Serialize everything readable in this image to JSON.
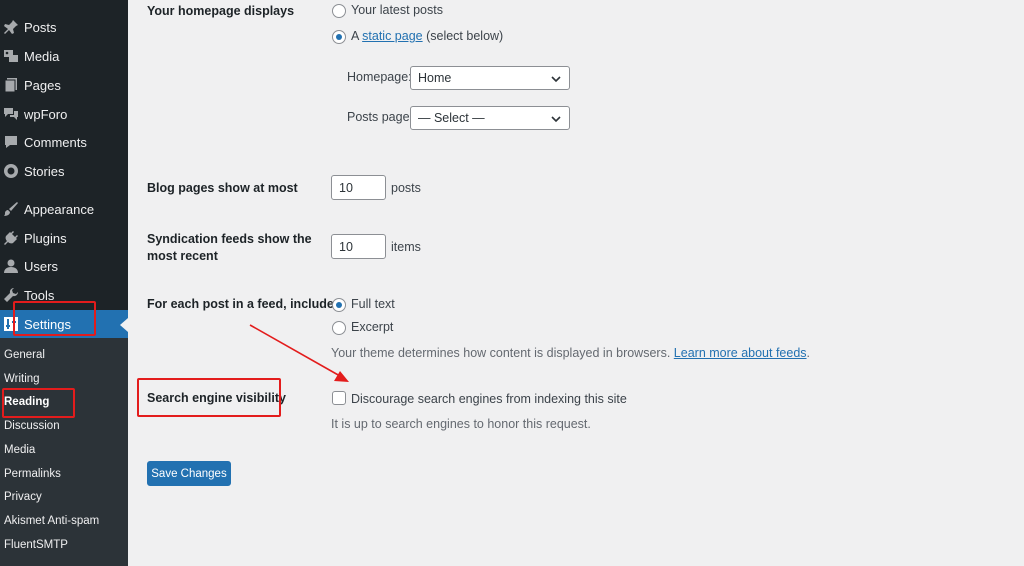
{
  "sidebar": {
    "items": [
      {
        "label": "Posts",
        "icon": "pin-icon"
      },
      {
        "label": "Media",
        "icon": "media-icon"
      },
      {
        "label": "Pages",
        "icon": "pages-icon"
      },
      {
        "label": "wpForo",
        "icon": "forum-icon"
      },
      {
        "label": "Comments",
        "icon": "comment-icon"
      },
      {
        "label": "Stories",
        "icon": "stories-icon"
      },
      {
        "label": "Appearance",
        "icon": "brush-icon"
      },
      {
        "label": "Plugins",
        "icon": "plug-icon"
      },
      {
        "label": "Users",
        "icon": "users-icon"
      },
      {
        "label": "Tools",
        "icon": "wrench-icon"
      },
      {
        "label": "Settings",
        "icon": "settings-icon"
      }
    ],
    "submenu": [
      "General",
      "Writing",
      "Reading",
      "Discussion",
      "Media",
      "Permalinks",
      "Privacy",
      "Akismet Anti-spam",
      "FluentSMTP"
    ]
  },
  "homepage": {
    "label": "Your homepage displays",
    "option_latest": "Your latest posts",
    "option_static_prefix": "A",
    "option_static_link": "static page",
    "option_static_suffix": "(select below)",
    "homepage_label": "Homepage:",
    "homepage_value": "Home",
    "posts_page_label": "Posts page:",
    "posts_page_value": "— Select —"
  },
  "blog_pages": {
    "label": "Blog pages show at most",
    "value": "10",
    "unit": "posts"
  },
  "syndication": {
    "label_line1": "Syndication feeds show the",
    "label_line2": "most recent",
    "value": "10",
    "unit": "items"
  },
  "feed_include": {
    "label": "For each post in a feed, include",
    "option_full": "Full text",
    "option_excerpt": "Excerpt",
    "desc_prefix": "Your theme determines how content is displayed in browsers.",
    "desc_link": "Learn more about feeds",
    "desc_suffix": "."
  },
  "search_visibility": {
    "label": "Search engine visibility",
    "checkbox_label": "Discourage search engines from indexing this site",
    "desc": "It is up to search engines to honor this request."
  },
  "save_label": "Save Changes",
  "colors": {
    "accent": "#2271b1",
    "sidebar_bg": "#1d2327",
    "highlight": "#e31c1c"
  }
}
